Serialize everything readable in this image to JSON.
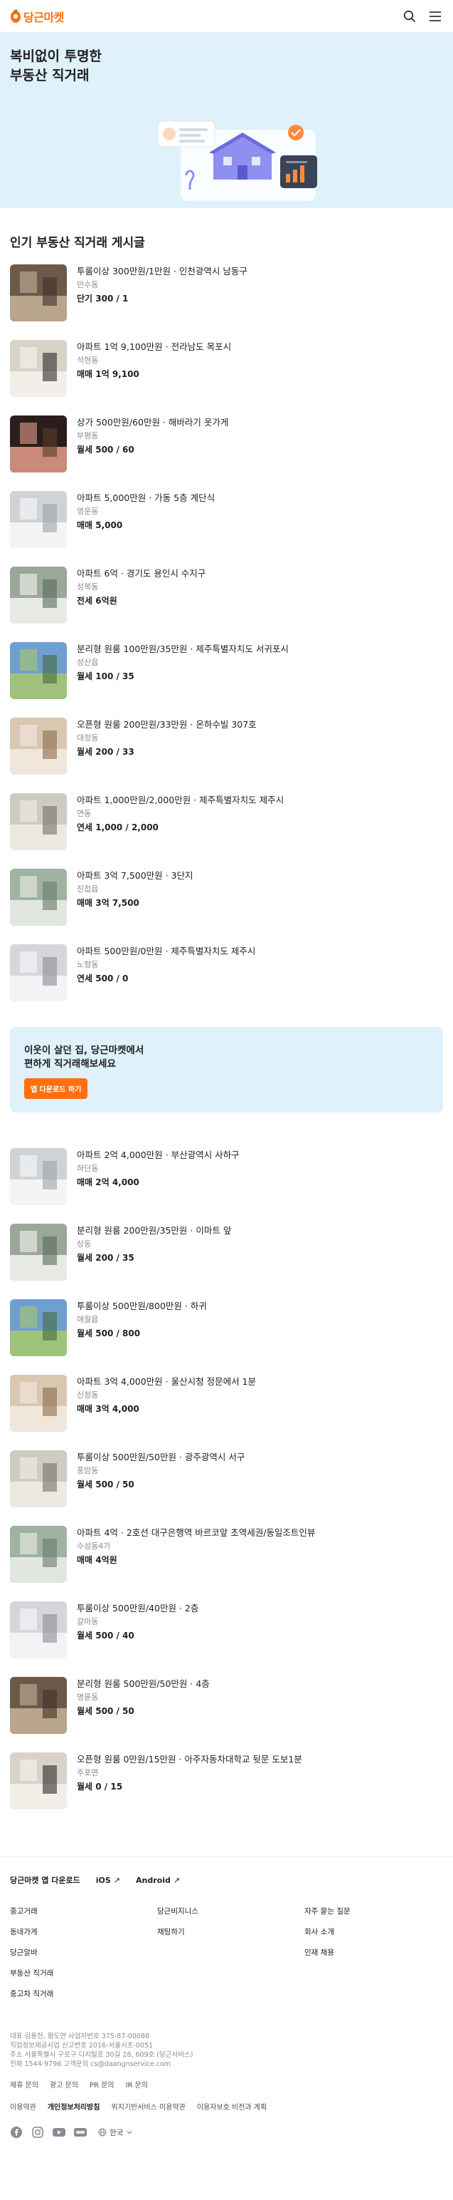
{
  "header": {
    "logo_text": "당근마켓",
    "brand_color": "#ff6f0f",
    "icons": [
      "search-icon",
      "menu-icon"
    ]
  },
  "hero": {
    "title": "복비없이 투명한\n부동산 직거래",
    "bg_color": "#dff1fb"
  },
  "section": {
    "title": "인기 부동산 직거래 게시글"
  },
  "listings_a": [
    {
      "title": "투룸이상 300만원/1만원 · 인천광역시 남동구",
      "location": "만수동",
      "price": "단기 300 / 1"
    },
    {
      "title": "아파트 1억 9,100만원 · 전라남도 목포시",
      "location": "석현동",
      "price": "매매 1억 9,100"
    },
    {
      "title": "상가 500만원/60만원 · 해바라기 옷가게",
      "location": "부평동",
      "price": "월세 500 / 60"
    },
    {
      "title": "아파트 5,000만원 · 가동 5층 계단식",
      "location": "영운동",
      "price": "매매 5,000"
    },
    {
      "title": "아파트 6억 · 경기도 용인시 수지구",
      "location": "성복동",
      "price": "전세 6억원"
    },
    {
      "title": "분리형 원룸 100만원/35만원 · 제주특별자치도 서귀포시",
      "location": "성산읍",
      "price": "월세 100 / 35"
    },
    {
      "title": "오픈형 원룸 200만원/33만원 · 온하수빌 307호",
      "location": "대정동",
      "price": "월세 200 / 33"
    },
    {
      "title": "아파트 1,000만원/2,000만원 · 제주특별자치도 제주시",
      "location": "연동",
      "price": "연세 1,000 / 2,000"
    },
    {
      "title": "아파트 3억 7,500만원 · 3단지",
      "location": "진접읍",
      "price": "매매 3억 7,500"
    },
    {
      "title": "아파트 500만원/0만원 · 제주특별자치도 제주시",
      "location": "노형동",
      "price": "연세 500 / 0"
    }
  ],
  "banner": {
    "text": "이웃이 살던 집, 당근마켓에서\n편하게 직거래해보세요",
    "button_label": "앱 다운로드 하기"
  },
  "listings_b": [
    {
      "title": "아파트 2억 4,000만원 · 부산광역시 사하구",
      "location": "하단동",
      "price": "매매 2억 4,000"
    },
    {
      "title": "분리형 원룸 200만원/35만원 · 이마트 앞",
      "location": "상동",
      "price": "월세 200 / 35"
    },
    {
      "title": "투룸이상 500만원/800만원 · 하귀",
      "location": "애월읍",
      "price": "월세 500 / 800"
    },
    {
      "title": "아파트 3억 4,000만원 · 울산시청 정문에서 1분",
      "location": "신정동",
      "price": "매매 3억 4,000"
    },
    {
      "title": "투룸이상 500만원/50만원 · 광주광역시 서구",
      "location": "풍암동",
      "price": "월세 500 / 50"
    },
    {
      "title": "아파트 4억 · 2호선 대구은행역 바르코앞 초역세권/동일조트인뷰",
      "location": "수성동4가",
      "price": "매매 4억원"
    },
    {
      "title": "투룸이상 500만원/40만원 · 2층",
      "location": "갈마동",
      "price": "월세 500 / 40"
    },
    {
      "title": "분리형 원룸 500만원/50만원 · 4층",
      "location": "명륜동",
      "price": "월세 500 / 50"
    },
    {
      "title": "오픈형 원룸 0만원/15만원 · 아주자동차대학교 뒷문 도보1분",
      "location": "주포면",
      "price": "월세 0 / 15"
    }
  ],
  "footer": {
    "app_download_label": "당근마켓 앱 다운로드",
    "ios_label": "iOS",
    "android_label": "Android",
    "links": [
      "중고거래",
      "당근비지니스",
      "자주 묻는 질문",
      "동네가게",
      "채팅하기",
      "회사 소개",
      "당근알바",
      "",
      "인재 채용",
      "부동산 직거래",
      "",
      "",
      "중고차 직거래",
      "",
      ""
    ],
    "company_info": "대표 김용현, 황도연 사업자번호 375-87-00088\n직업정보제공사업 신고번호 2016-서울서초-0051\n주소 서울특별시 구로구 디지털로 30길 28, 609호 (당근서비스)\n전화 1544-9796 고객문의 cs@daangnservice.com",
    "inquiries": [
      "제휴 문의",
      "광고 문의",
      "PR 문의",
      "IR 문의"
    ],
    "policies": [
      "이용약관",
      "개인정보처리방침",
      "위치기반서비스 이용약관",
      "이용자보호 비전과 계획"
    ],
    "social_icons": [
      "facebook-icon",
      "instagram-icon",
      "youtube-icon",
      "blog-icon"
    ],
    "language_label": "한국"
  }
}
